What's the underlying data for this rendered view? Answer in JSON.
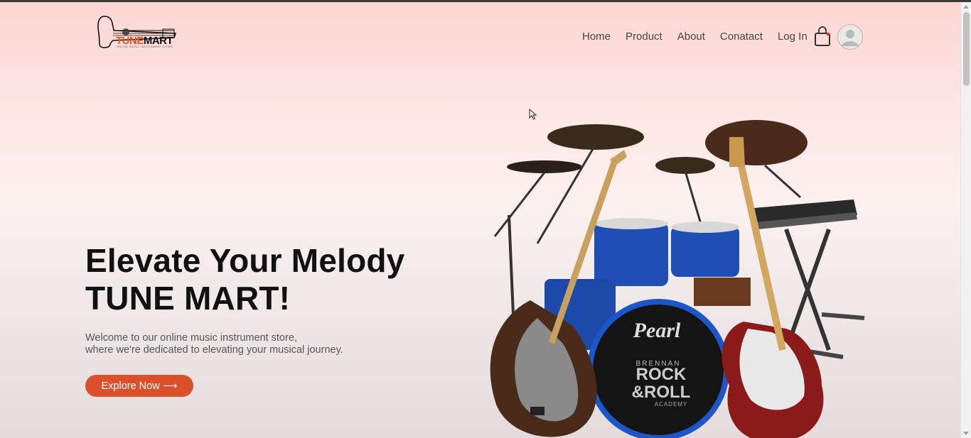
{
  "header": {
    "logo": {
      "tune": "TUNE",
      "mart": "MART",
      "tagline": "ONLINE MUSIC INSTRUMENT STORE"
    },
    "nav": [
      {
        "label": "Home"
      },
      {
        "label": "Product"
      },
      {
        "label": "About"
      },
      {
        "label": "Conatact"
      },
      {
        "label": "Log In"
      }
    ],
    "cart_icon": "shopping-bag-icon",
    "avatar_icon": "user-avatar-icon"
  },
  "hero": {
    "title_line1": "Elevate Your Melody",
    "title_line2": "TUNE MART!",
    "subtitle_line1": "Welcome to our online music instrument store,",
    "subtitle_line2": "where we're dedicated to elevating your musical journey.",
    "cta_label": "Explore Now ⟶",
    "image": {
      "drum_brand": "Pearl",
      "drum_text1": "BRENNAN",
      "drum_text2": "ROCK",
      "drum_text3": "&ROLL",
      "drum_text4": "ACADEMY"
    }
  },
  "colors": {
    "accent": "#d9502a",
    "brand_orange": "#e0562a",
    "text": "#111111"
  }
}
